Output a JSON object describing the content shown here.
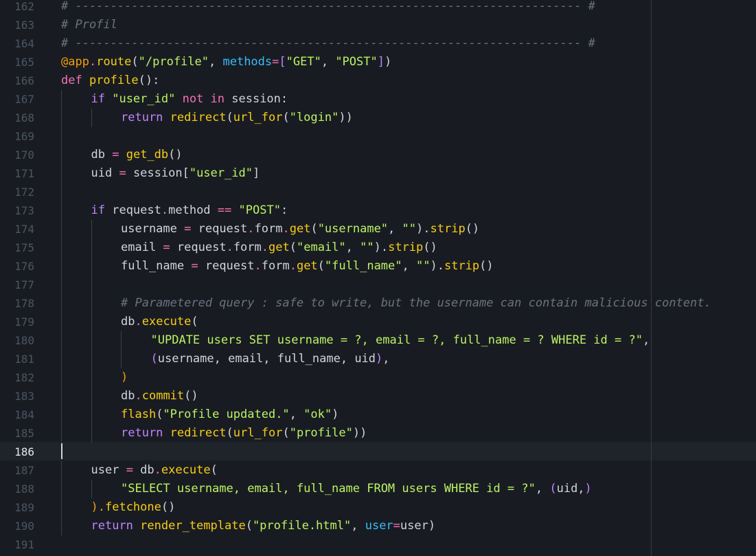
{
  "editor": {
    "active_line": 186,
    "colors": {
      "background": "#181c22",
      "active_line": "#1f242b",
      "gutter_text": "#4b5563",
      "gutter_active": "#e5e7eb",
      "plain": "#d1d5db",
      "comment": "#6b7280",
      "keyword": "#c084fc",
      "operator": "#f472b6",
      "function": "#facc15",
      "string": "#bef264",
      "decorator": "#f59e0b",
      "parameter": "#38bdf8"
    },
    "lines": [
      {
        "num": 162,
        "indent": 0,
        "tokens": [
          {
            "t": "# ------------------------------------------------------------------------ #",
            "c": "comment"
          }
        ]
      },
      {
        "num": 163,
        "indent": 0,
        "tokens": [
          {
            "t": "# Profil",
            "c": "comment"
          }
        ]
      },
      {
        "num": 164,
        "indent": 0,
        "tokens": [
          {
            "t": "# ------------------------------------------------------------------------ #",
            "c": "comment"
          }
        ]
      },
      {
        "num": 165,
        "indent": 0,
        "tokens": [
          {
            "t": "@app",
            "c": "decorator"
          },
          {
            "t": ".",
            "c": "operator"
          },
          {
            "t": "route",
            "c": "function"
          },
          {
            "t": "(",
            "c": "plain"
          },
          {
            "t": "\"/profile\"",
            "c": "string"
          },
          {
            "t": ", ",
            "c": "plain"
          },
          {
            "t": "methods",
            "c": "parameter"
          },
          {
            "t": "=",
            "c": "operator"
          },
          {
            "t": "[",
            "c": "keyword"
          },
          {
            "t": "\"GET\"",
            "c": "string"
          },
          {
            "t": ", ",
            "c": "plain"
          },
          {
            "t": "\"POST\"",
            "c": "string"
          },
          {
            "t": "]",
            "c": "keyword"
          },
          {
            "t": ")",
            "c": "plain"
          }
        ]
      },
      {
        "num": 166,
        "indent": 0,
        "tokens": [
          {
            "t": "def ",
            "c": "operator"
          },
          {
            "t": "profile",
            "c": "function"
          },
          {
            "t": "():",
            "c": "plain"
          }
        ]
      },
      {
        "num": 167,
        "indent": 1,
        "tokens": [
          {
            "t": "if ",
            "c": "keyword"
          },
          {
            "t": "\"user_id\"",
            "c": "string"
          },
          {
            "t": " ",
            "c": "plain"
          },
          {
            "t": "not in",
            "c": "operator"
          },
          {
            "t": " session:",
            "c": "plain"
          }
        ]
      },
      {
        "num": 168,
        "indent": 2,
        "tokens": [
          {
            "t": "return ",
            "c": "keyword"
          },
          {
            "t": "redirect",
            "c": "function"
          },
          {
            "t": "(",
            "c": "plain"
          },
          {
            "t": "url_for",
            "c": "function"
          },
          {
            "t": "(",
            "c": "plain"
          },
          {
            "t": "\"login\"",
            "c": "string"
          },
          {
            "t": "))",
            "c": "plain"
          }
        ]
      },
      {
        "num": 169,
        "indent": 0,
        "tokens": []
      },
      {
        "num": 170,
        "indent": 1,
        "tokens": [
          {
            "t": "db ",
            "c": "plain"
          },
          {
            "t": "=",
            "c": "operator"
          },
          {
            "t": " ",
            "c": "plain"
          },
          {
            "t": "get_db",
            "c": "function"
          },
          {
            "t": "()",
            "c": "plain"
          }
        ]
      },
      {
        "num": 171,
        "indent": 1,
        "tokens": [
          {
            "t": "uid ",
            "c": "plain"
          },
          {
            "t": "=",
            "c": "operator"
          },
          {
            "t": " session[",
            "c": "plain"
          },
          {
            "t": "\"user_id\"",
            "c": "string"
          },
          {
            "t": "]",
            "c": "plain"
          }
        ]
      },
      {
        "num": 172,
        "indent": 0,
        "tokens": []
      },
      {
        "num": 173,
        "indent": 1,
        "tokens": [
          {
            "t": "if ",
            "c": "keyword"
          },
          {
            "t": "request",
            "c": "plain"
          },
          {
            "t": ".",
            "c": "operator"
          },
          {
            "t": "method ",
            "c": "plain"
          },
          {
            "t": "==",
            "c": "operator"
          },
          {
            "t": " ",
            "c": "plain"
          },
          {
            "t": "\"POST\"",
            "c": "string"
          },
          {
            "t": ":",
            "c": "plain"
          }
        ]
      },
      {
        "num": 174,
        "indent": 2,
        "tokens": [
          {
            "t": "username ",
            "c": "plain"
          },
          {
            "t": "=",
            "c": "operator"
          },
          {
            "t": " request",
            "c": "plain"
          },
          {
            "t": ".",
            "c": "operator"
          },
          {
            "t": "form",
            "c": "plain"
          },
          {
            "t": ".",
            "c": "operator"
          },
          {
            "t": "get",
            "c": "function"
          },
          {
            "t": "(",
            "c": "plain"
          },
          {
            "t": "\"username\"",
            "c": "string"
          },
          {
            "t": ", ",
            "c": "plain"
          },
          {
            "t": "\"\"",
            "c": "string"
          },
          {
            "t": ").",
            "c": "plain"
          },
          {
            "t": "strip",
            "c": "function"
          },
          {
            "t": "()",
            "c": "plain"
          }
        ]
      },
      {
        "num": 175,
        "indent": 2,
        "tokens": [
          {
            "t": "email ",
            "c": "plain"
          },
          {
            "t": "=",
            "c": "operator"
          },
          {
            "t": " request",
            "c": "plain"
          },
          {
            "t": ".",
            "c": "operator"
          },
          {
            "t": "form",
            "c": "plain"
          },
          {
            "t": ".",
            "c": "operator"
          },
          {
            "t": "get",
            "c": "function"
          },
          {
            "t": "(",
            "c": "plain"
          },
          {
            "t": "\"email\"",
            "c": "string"
          },
          {
            "t": ", ",
            "c": "plain"
          },
          {
            "t": "\"\"",
            "c": "string"
          },
          {
            "t": ").",
            "c": "plain"
          },
          {
            "t": "strip",
            "c": "function"
          },
          {
            "t": "()",
            "c": "plain"
          }
        ]
      },
      {
        "num": 176,
        "indent": 2,
        "tokens": [
          {
            "t": "full_name ",
            "c": "plain"
          },
          {
            "t": "=",
            "c": "operator"
          },
          {
            "t": " request",
            "c": "plain"
          },
          {
            "t": ".",
            "c": "operator"
          },
          {
            "t": "form",
            "c": "plain"
          },
          {
            "t": ".",
            "c": "operator"
          },
          {
            "t": "get",
            "c": "function"
          },
          {
            "t": "(",
            "c": "plain"
          },
          {
            "t": "\"full_name\"",
            "c": "string"
          },
          {
            "t": ", ",
            "c": "plain"
          },
          {
            "t": "\"\"",
            "c": "string"
          },
          {
            "t": ").",
            "c": "plain"
          },
          {
            "t": "strip",
            "c": "function"
          },
          {
            "t": "()",
            "c": "plain"
          }
        ]
      },
      {
        "num": 177,
        "indent": 0,
        "tokens": []
      },
      {
        "num": 178,
        "indent": 2,
        "tokens": [
          {
            "t": "# Parametered query : safe to write, but the username can contain malicious content.",
            "c": "comment"
          }
        ]
      },
      {
        "num": 179,
        "indent": 2,
        "tokens": [
          {
            "t": "db",
            "c": "plain"
          },
          {
            "t": ".",
            "c": "operator"
          },
          {
            "t": "execute",
            "c": "function"
          },
          {
            "t": "(",
            "c": "plain"
          }
        ]
      },
      {
        "num": 180,
        "indent": 3,
        "tokens": [
          {
            "t": "\"UPDATE users SET username = ?, email = ?, full_name = ? WHERE id = ?\"",
            "c": "string"
          },
          {
            "t": ",",
            "c": "plain"
          }
        ]
      },
      {
        "num": 181,
        "indent": 3,
        "tokens": [
          {
            "t": "(",
            "c": "keyword"
          },
          {
            "t": "username, email, full_name, uid",
            "c": "plain"
          },
          {
            "t": ")",
            "c": "keyword"
          },
          {
            "t": ",",
            "c": "plain"
          }
        ]
      },
      {
        "num": 182,
        "indent": 2,
        "tokens": [
          {
            "t": ")",
            "c": "decorator"
          }
        ]
      },
      {
        "num": 183,
        "indent": 2,
        "tokens": [
          {
            "t": "db",
            "c": "plain"
          },
          {
            "t": ".",
            "c": "operator"
          },
          {
            "t": "commit",
            "c": "function"
          },
          {
            "t": "()",
            "c": "plain"
          }
        ]
      },
      {
        "num": 184,
        "indent": 2,
        "tokens": [
          {
            "t": "flash",
            "c": "function"
          },
          {
            "t": "(",
            "c": "plain"
          },
          {
            "t": "\"Profile updated.\"",
            "c": "string"
          },
          {
            "t": ", ",
            "c": "plain"
          },
          {
            "t": "\"ok\"",
            "c": "string"
          },
          {
            "t": ")",
            "c": "plain"
          }
        ]
      },
      {
        "num": 185,
        "indent": 2,
        "tokens": [
          {
            "t": "return ",
            "c": "keyword"
          },
          {
            "t": "redirect",
            "c": "function"
          },
          {
            "t": "(",
            "c": "plain"
          },
          {
            "t": "url_for",
            "c": "function"
          },
          {
            "t": "(",
            "c": "plain"
          },
          {
            "t": "\"profile\"",
            "c": "string"
          },
          {
            "t": "))",
            "c": "plain"
          }
        ]
      },
      {
        "num": 186,
        "indent": 0,
        "tokens": []
      },
      {
        "num": 187,
        "indent": 1,
        "tokens": [
          {
            "t": "user ",
            "c": "plain"
          },
          {
            "t": "=",
            "c": "operator"
          },
          {
            "t": " db",
            "c": "plain"
          },
          {
            "t": ".",
            "c": "operator"
          },
          {
            "t": "execute",
            "c": "function"
          },
          {
            "t": "(",
            "c": "plain"
          }
        ]
      },
      {
        "num": 188,
        "indent": 2,
        "tokens": [
          {
            "t": "\"SELECT username, email, full_name FROM users WHERE id = ?\"",
            "c": "string"
          },
          {
            "t": ", ",
            "c": "plain"
          },
          {
            "t": "(",
            "c": "keyword"
          },
          {
            "t": "uid,",
            "c": "plain"
          },
          {
            "t": ")",
            "c": "keyword"
          }
        ]
      },
      {
        "num": 189,
        "indent": 1,
        "tokens": [
          {
            "t": ").",
            "c": "decorator"
          },
          {
            "t": "fetchone",
            "c": "function"
          },
          {
            "t": "()",
            "c": "plain"
          }
        ]
      },
      {
        "num": 190,
        "indent": 1,
        "tokens": [
          {
            "t": "return ",
            "c": "keyword"
          },
          {
            "t": "render_template",
            "c": "function"
          },
          {
            "t": "(",
            "c": "plain"
          },
          {
            "t": "\"profile.html\"",
            "c": "string"
          },
          {
            "t": ", ",
            "c": "plain"
          },
          {
            "t": "user",
            "c": "parameter"
          },
          {
            "t": "=",
            "c": "operator"
          },
          {
            "t": "user",
            "c": "plain"
          },
          {
            "t": ")",
            "c": "plain"
          }
        ]
      },
      {
        "num": 191,
        "indent": 0,
        "tokens": []
      }
    ]
  }
}
